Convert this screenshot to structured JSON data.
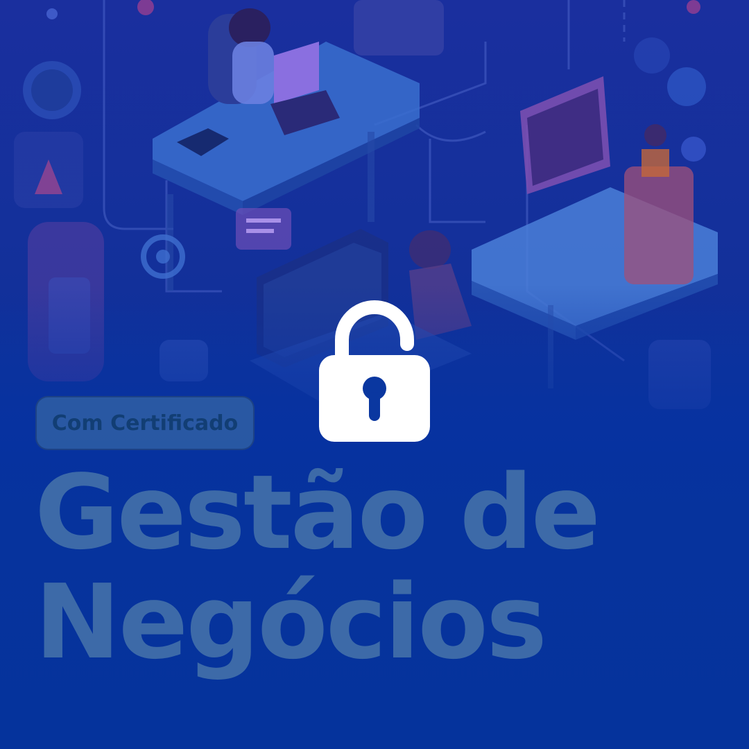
{
  "badge": {
    "label": "Com Certificado"
  },
  "title": {
    "line1": "Gestão de",
    "line2": "Negócios"
  },
  "icons": {
    "center": "lock-icon",
    "illustration": "isometric-office-illustration"
  },
  "colors": {
    "background": "#05339c",
    "title": "#3d6aa8",
    "badge_text": "#123e74",
    "lock": "#ffffff"
  }
}
